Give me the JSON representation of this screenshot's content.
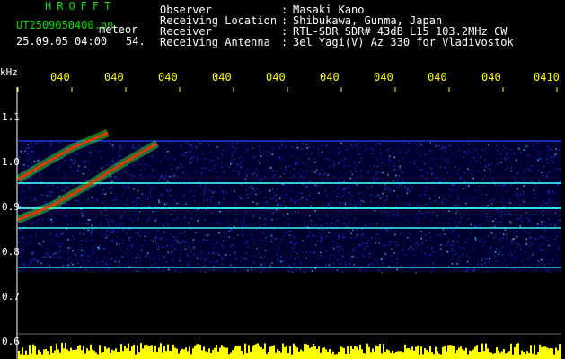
{
  "header": {
    "app_title": "HROFFT",
    "file_name": "UT2509050400.pn",
    "file_suffix": "meteor",
    "date": "25.09.05 04:00",
    "date_sub": "54.",
    "fields": [
      {
        "label": "Observer",
        "value": "Masaki Kano"
      },
      {
        "label": "Receiving Location",
        "value": "Shibukawa, Gunma, Japan"
      },
      {
        "label": "Receiver",
        "value": "RTL-SDR SDR# 43dB L15 103.2MHz CW"
      },
      {
        "label": "Receiving Antenna",
        "value": "3el Yagi(V) Az 330 for Vladivostok"
      }
    ],
    "colon": ":"
  },
  "axes": {
    "y_unit": "kHz",
    "y_ticks": [
      "1.1",
      "1.0",
      "0.9",
      "0.8",
      "0.7",
      "0.6"
    ],
    "x_ticks": [
      "040",
      "040",
      "040",
      "040",
      "040",
      "040",
      "040",
      "040",
      "040",
      "0410"
    ]
  },
  "colors": {
    "header_green": "#00e000",
    "header_white": "#ffffff",
    "tick_yellow": "#ffff00",
    "spectrogram_bg": "#000030",
    "noise_blue": "#1a3cff",
    "signal_cyan": "#40ffff",
    "meteor_red": "#ff3000",
    "power_bar_yellow": "#ffff00"
  }
}
